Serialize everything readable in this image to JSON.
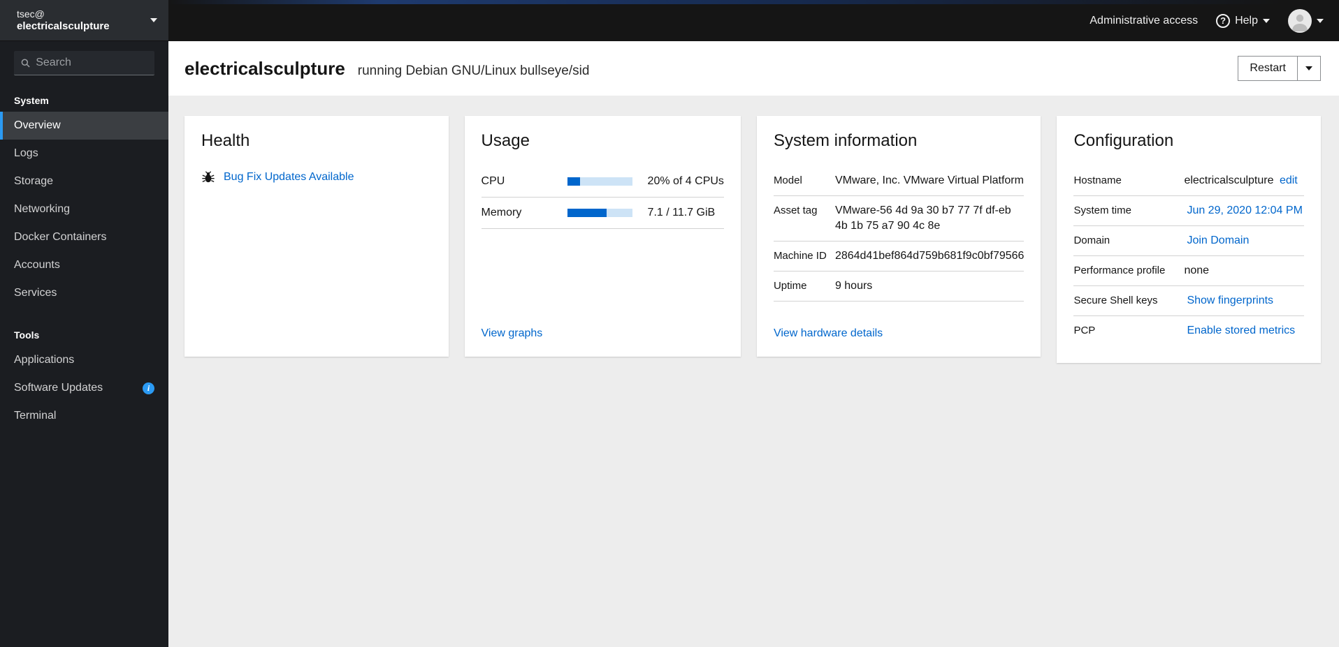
{
  "colors": {
    "accent": "#2b9af3",
    "link": "#0066cc",
    "masthead_bg": "#151515",
    "sidebar_bg": "#1b1d21",
    "progress_fill": "#0066cc",
    "progress_track": "#cde3f6"
  },
  "sidebar": {
    "host_user": "tsec@",
    "host_name": "electricalsculpture",
    "search_placeholder": "Search",
    "sections": [
      {
        "label": "System",
        "items": [
          {
            "label": "Overview",
            "selected": true
          },
          {
            "label": "Logs"
          },
          {
            "label": "Storage"
          },
          {
            "label": "Networking"
          },
          {
            "label": "Docker Containers"
          },
          {
            "label": "Accounts"
          },
          {
            "label": "Services"
          }
        ]
      },
      {
        "label": "Tools",
        "items": [
          {
            "label": "Applications"
          },
          {
            "label": "Software Updates",
            "badge": "i"
          },
          {
            "label": "Terminal"
          }
        ]
      }
    ]
  },
  "masthead": {
    "admin_access_label": "Administrative access",
    "help_label": "Help",
    "help_icon_glyph": "?"
  },
  "page_header": {
    "hostname": "electricalsculpture",
    "subtitle": "running Debian GNU/Linux bullseye/sid",
    "restart_label": "Restart"
  },
  "cards": {
    "health": {
      "title": "Health",
      "bug_link": "Bug Fix Updates Available"
    },
    "usage": {
      "title": "Usage",
      "rows": [
        {
          "label": "CPU",
          "percent": 20,
          "value": "20% of 4 CPUs"
        },
        {
          "label": "Memory",
          "percent": 61,
          "value": "7.1 / 11.7 GiB"
        }
      ],
      "footer_link": "View graphs"
    },
    "system_information": {
      "title": "System information",
      "rows": [
        {
          "label": "Model",
          "value": "VMware, Inc. VMware Virtual Platform"
        },
        {
          "label": "Asset tag",
          "value": "VMware-56 4d 9a 30 b7 77 7f df-eb 4b 1b 75 a7 90 4c 8e"
        },
        {
          "label": "Machine ID",
          "value": "2864d41bef864d759b681f9c0bf79566"
        },
        {
          "label": "Uptime",
          "value": "9 hours"
        }
      ],
      "footer_link": "View hardware details"
    },
    "configuration": {
      "title": "Configuration",
      "rows": [
        {
          "label": "Hostname",
          "value": "electricalsculpture",
          "link": "edit"
        },
        {
          "label": "System time",
          "link": "Jun 29, 2020 12:04 PM"
        },
        {
          "label": "Domain",
          "link": "Join Domain"
        },
        {
          "label": "Performance profile",
          "value": "none"
        },
        {
          "label": "Secure Shell keys",
          "link": "Show fingerprints"
        },
        {
          "label": "PCP",
          "link": "Enable stored metrics"
        }
      ]
    }
  }
}
